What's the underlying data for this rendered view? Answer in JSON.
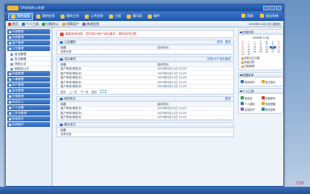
{
  "window": {
    "title": "OA协同办公系统"
  },
  "nav": {
    "items": [
      {
        "label": "我的桌面",
        "active": true
      },
      {
        "label": "我的信息",
        "active": false
      },
      {
        "label": "我的工作",
        "active": false
      },
      {
        "label": "公共信息",
        "active": false
      },
      {
        "label": "日程",
        "active": false
      },
      {
        "label": "通讯录",
        "active": false
      },
      {
        "label": "邮件",
        "active": false
      }
    ],
    "right": [
      "帮助",
      "退出系统"
    ]
  },
  "toolbar": {
    "items": [
      "首页",
      "个人工具",
      "切换办公",
      "切换用户",
      "修改信息"
    ],
    "status": "2009年11月13日 星期五"
  },
  "sidebar": {
    "groups": [
      "内部管理",
      "系统管理",
      "客户管理",
      "公文管理"
    ],
    "subitems": [
      "收文管理",
      "发文管理",
      "待阅公文",
      "回收站公文"
    ],
    "groups2": [
      "档案管理",
      "人事管理",
      "资产管理",
      "会议管理",
      "车辆管理",
      "综合办公",
      "个人设置",
      "工作流管理",
      "信息发布",
      "系统维护"
    ]
  },
  "notice": {
    "text": "最新系统消息：您共有29条个待办事件，请您及时处理。"
  },
  "panels": [
    {
      "title": "公告通知",
      "more": [
        "发布",
        "更多"
      ],
      "head": [
        "标题",
        "发布时间"
      ],
      "rows": [
        [
          "没有记录",
          ""
        ]
      ]
    },
    {
      "title": "待办事项",
      "more": [
        "共有29个待办事件"
      ],
      "head": [
        "标题",
        "接收时间"
      ],
      "rows": [
        [
          "客户申请(审批中)",
          "2009年5月11日 10:25"
        ],
        [
          "客户申请(审批中)",
          "2009年5月11日 10:25"
        ],
        [
          "客户申请(审批中)",
          "2009年5月11日 10:25"
        ],
        [
          "客户申请(审批中)",
          "2009年5月11日 10:25"
        ],
        [
          "客户申请(审批中)",
          "2009年5月11日 10:25"
        ]
      ],
      "pager": [
        "首页",
        "上一页",
        "下一页",
        "尾页"
      ]
    },
    {
      "title": "我的收文",
      "more": [
        "更多"
      ],
      "head": [
        "标题",
        "接收时间"
      ],
      "rows": [
        [
          "客户申请(审批中)",
          "2009年5月11日 10:25"
        ],
        [
          "客户申请(审批中)",
          "2009年5月11日 10:25"
        ],
        [
          "客户申请(审批中)",
          "2009年5月11日 10:25"
        ]
      ]
    },
    {
      "title": "最近发文",
      "more": [],
      "head": [
        "标题",
        ""
      ],
      "rows": [
        [
          "没有记录",
          ""
        ]
      ]
    }
  ],
  "calendar": {
    "title": "日程安排",
    "month": "2009年 11月",
    "weekdays": [
      "日",
      "一",
      "二",
      "三",
      "四",
      "五",
      "六"
    ],
    "days": [
      "1",
      "2",
      "3",
      "4",
      "5",
      "6",
      "7",
      "8",
      "9",
      "10",
      "11",
      "12",
      "13",
      "14",
      "15",
      "16",
      "17",
      "18",
      "19",
      "20",
      "21",
      "22",
      "23",
      "24",
      "25",
      "26",
      "27",
      "28",
      "29",
      "30"
    ],
    "today": "13",
    "links": [
      "查看当日日程",
      "新建日程",
      "日程管理"
    ]
  },
  "quicklinks": {
    "title": "快捷菜单",
    "items": [
      "修改资料",
      "发文登记"
    ]
  },
  "tools": {
    "title": "个人工具",
    "items": [
      "短消息",
      "内部邮件",
      "个人通讯",
      "系统提醒",
      "区域用户",
      "修改密码"
    ]
  },
  "signature": "刘丽"
}
